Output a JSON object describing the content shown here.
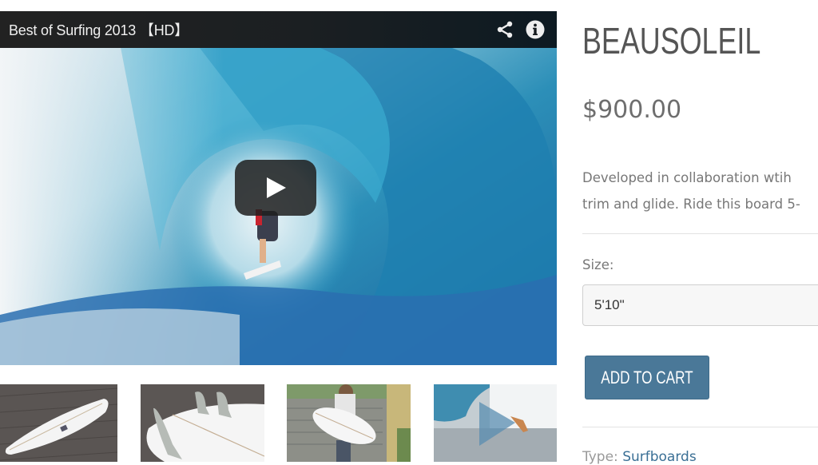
{
  "video": {
    "title": "Best of Surfing 2013 【HD】",
    "share_icon": "share-icon",
    "info_icon": "info-icon",
    "play_icon": "play-icon"
  },
  "thumbnails": [
    {
      "label": "surfboard-top-view"
    },
    {
      "label": "surfboard-fins"
    },
    {
      "label": "man-holding-surfboard"
    },
    {
      "label": "video-thumbnail-surfing"
    }
  ],
  "product": {
    "title": "BEAUSOLEIL",
    "price": "$900.00",
    "description_lines": [
      "Developed in collaboration wtih",
      "trim and glide. Ride this board 5-"
    ],
    "size_label": "Size:",
    "size_value": "5'10\"",
    "add_to_cart_label": "ADD TO CART",
    "type_label": "Type:",
    "type_value": "Surfboards"
  },
  "colors": {
    "button": "#4a7898",
    "link": "#3a6f95",
    "title": "#555555"
  }
}
